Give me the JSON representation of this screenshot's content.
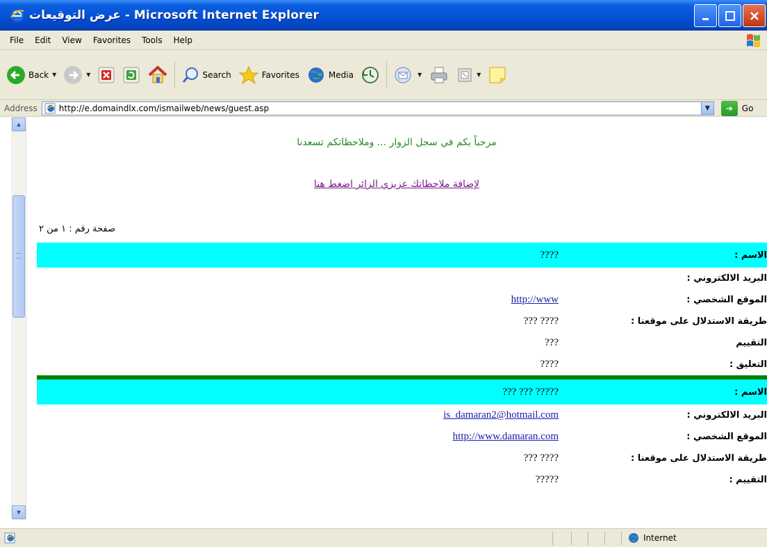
{
  "window": {
    "title": "عرض التوقيعات - Microsoft Internet Explorer",
    "minimize": "_",
    "maximize": "□",
    "close": "✕"
  },
  "menu": [
    "File",
    "Edit",
    "View",
    "Favorites",
    "Tools",
    "Help"
  ],
  "toolbar": {
    "back": "Back",
    "search": "Search",
    "favorites": "Favorites",
    "media": "Media"
  },
  "address": {
    "label": "Address",
    "url": "http://e.domaindlx.com/ismailweb/news/guest.asp",
    "go": "Go"
  },
  "page": {
    "welcome": "مرحباً بكم في سجل الزوار ... وملاحظاتكم تسعدنا",
    "add_link": "لإضافة ملاحظاتك عزيزي الزائر اضغط هنا",
    "page_number": "صفحة رقم : ١ من ٢"
  },
  "labels": {
    "name": "الاسم :",
    "email": "البريد الالكتروني :",
    "website": "الموقع الشخصي :",
    "referral": "طريقة الاستدلال على موقعنا :",
    "rating": "التقييم",
    "comment": "التعليق :",
    "rating_colon": "التقييم :"
  },
  "entries": [
    {
      "name": "????",
      "email": "",
      "website": "http://www",
      "referral": "??? ????",
      "rating": "???",
      "comment": "????"
    },
    {
      "name": "??? ??? ?????",
      "email": "is_damaran2@hotmail.com",
      "website": "http://www.damaran.com",
      "referral": "??? ????",
      "rating": "?????"
    }
  ],
  "status": {
    "zone": "Internet"
  }
}
